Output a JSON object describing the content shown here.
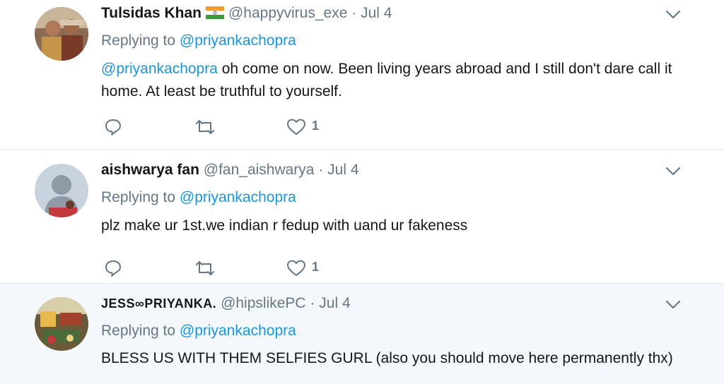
{
  "colors": {
    "link": "#1b95e0",
    "secondary": "#657786",
    "text": "#14171a",
    "divider": "#e1e8ed",
    "highlight_bg": "#f5f8fa"
  },
  "tweets": [
    {
      "fullname": "Tulsidas Khan",
      "flag_icon": "india-flag-icon",
      "handle": "@happyvirus_exe",
      "separator": "·",
      "date": "Jul 4",
      "replying_prefix": "Replying to",
      "replying_to": "@priyankachopra",
      "text_mention": "@priyankachopra",
      "text": " oh come on now. Been living years abroad and I still don't dare call it home. At least be truthful to yourself.",
      "reply_icon": "reply-icon",
      "retweet_icon": "retweet-icon",
      "like_icon": "heart-icon",
      "like_count": "1"
    },
    {
      "fullname": "aishwarya fan",
      "handle": "@fan_aishwarya",
      "separator": "·",
      "date": "Jul 4",
      "replying_prefix": "Replying to",
      "replying_to": "@priyankachopra",
      "text": "plz make ur 1st.we indian r fedup with uand ur fakeness",
      "reply_icon": "reply-icon",
      "retweet_icon": "retweet-icon",
      "like_icon": "heart-icon",
      "like_count": "1"
    },
    {
      "fullname": "JESS∞PRIYANKA.",
      "handle": "@hipslikePC",
      "separator": "·",
      "date": "Jul 4",
      "replying_prefix": "Replying to",
      "replying_to": "@priyankachopra",
      "text": "BLESS US WITH THEM SELFIES GURL (also you should move here permanently thx)"
    }
  ]
}
